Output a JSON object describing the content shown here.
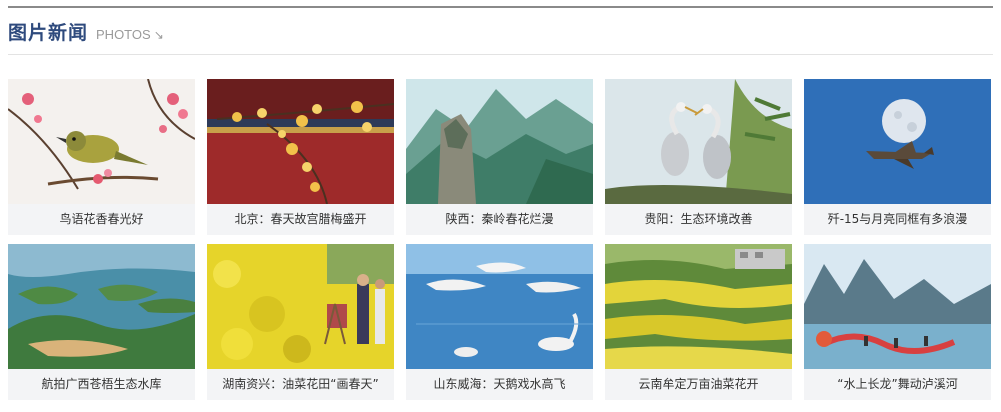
{
  "section": {
    "title": "图片新闻",
    "subtitle": "PHOTOS",
    "arrow_icon": "arrow-down-right-icon"
  },
  "cards": [
    {
      "caption": "鸟语花香春光好",
      "image": "bird-on-blossom-branch"
    },
    {
      "caption": "北京：春天故宫腊梅盛开",
      "image": "wintersweet-blossoms-red-palace"
    },
    {
      "caption": "陕西：秦岭春花烂漫",
      "image": "qinling-mountain-peaks"
    },
    {
      "caption": "贵阳：生态环境改善",
      "image": "herons-on-pine-branch"
    },
    {
      "caption": "歼-15与月亮同框有多浪漫",
      "image": "fighter-jet-and-moon"
    },
    {
      "caption": "航拍广西苍梧生态水库",
      "image": "aerial-reservoir-islands"
    },
    {
      "caption": "湖南资兴：油菜花田“画春天”",
      "image": "painters-in-rapeseed-field"
    },
    {
      "caption": "山东威海：天鹅戏水高飞",
      "image": "swans-on-water"
    },
    {
      "caption": "云南牟定万亩油菜花开",
      "image": "terraced-rapeseed-fields"
    },
    {
      "caption": "“水上长龙”舞动泸溪河",
      "image": "dragon-dance-on-river"
    }
  ]
}
